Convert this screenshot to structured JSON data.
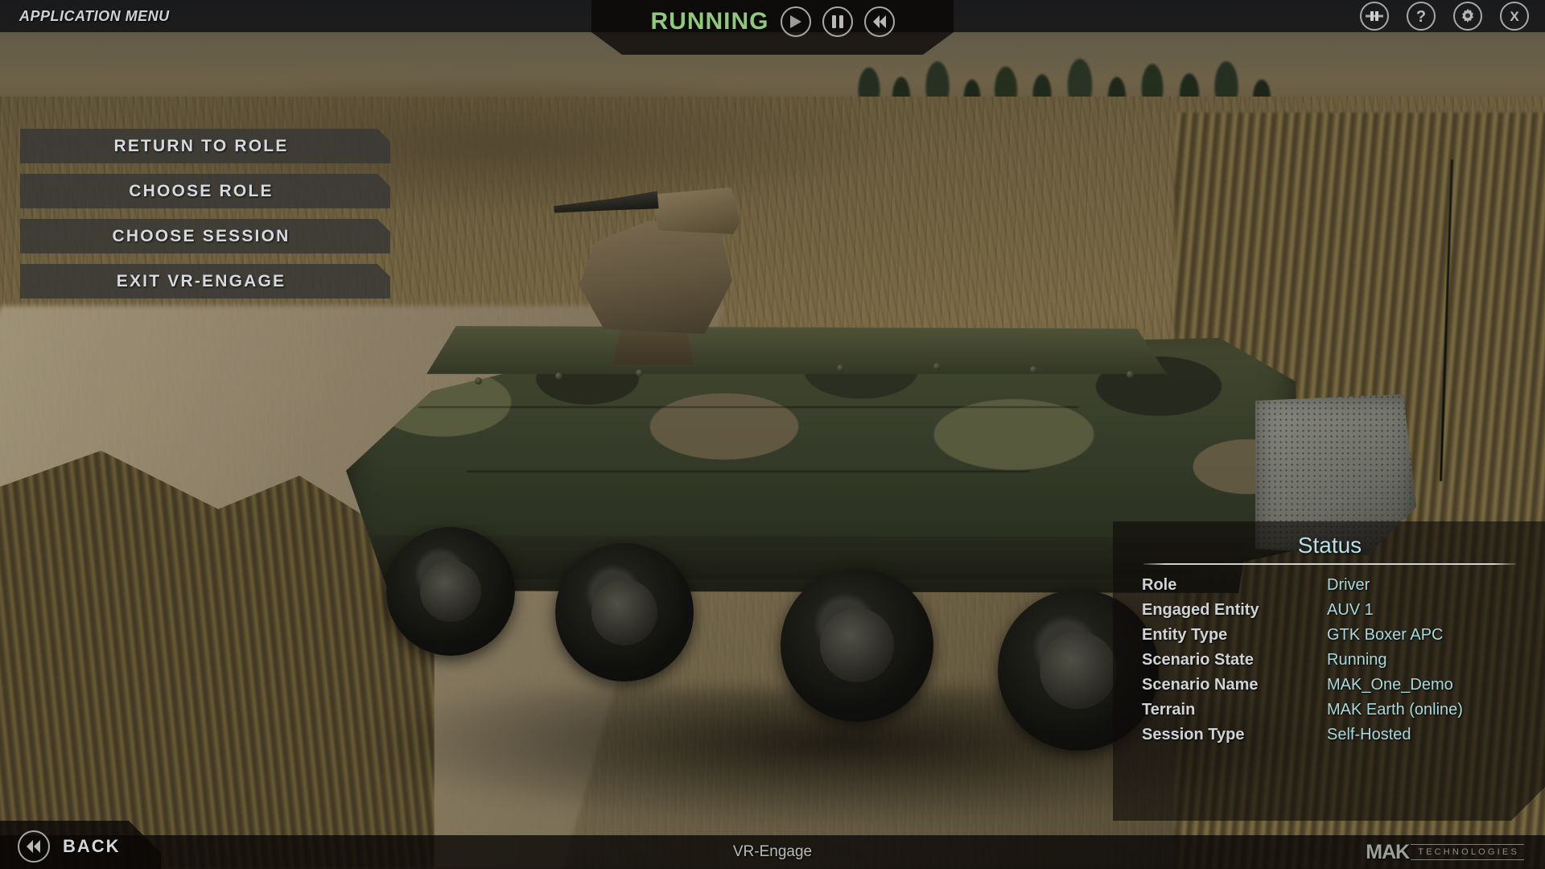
{
  "header": {
    "app_menu_title": "APPLICATION MENU",
    "status_word": "RUNNING",
    "playback": [
      {
        "name": "play-icon",
        "label": "Play"
      },
      {
        "name": "pause-icon",
        "label": "Pause"
      },
      {
        "name": "rewind-icon",
        "label": "Rewind"
      }
    ],
    "right_icons": [
      {
        "name": "sliders-icon",
        "label": "Simulation Controls"
      },
      {
        "name": "help-icon",
        "label": "Help"
      },
      {
        "name": "gear-icon",
        "label": "Settings"
      },
      {
        "name": "close-icon",
        "label": "Close"
      }
    ]
  },
  "menu": {
    "buttons": [
      {
        "label": "RETURN TO ROLE"
      },
      {
        "label": "CHOOSE ROLE"
      },
      {
        "label": "CHOOSE SESSION"
      },
      {
        "label": "EXIT VR-ENGAGE"
      }
    ]
  },
  "status_panel": {
    "title": "Status",
    "label_color": "#cfd3d6",
    "value_color": "#a7d8dd",
    "rows": [
      {
        "label": "Role",
        "value": "Driver"
      },
      {
        "label": "Engaged Entity",
        "value": "AUV 1"
      },
      {
        "label": "Entity Type",
        "value": "GTK Boxer APC"
      },
      {
        "label": "Scenario State",
        "value": "Running"
      },
      {
        "label": "Scenario Name",
        "value": "MAK_One_Demo"
      },
      {
        "label": "Terrain",
        "value": "MAK Earth (online)"
      },
      {
        "label": "Session Type",
        "value": "Self-Hosted"
      }
    ]
  },
  "footer": {
    "back_label": "BACK",
    "back_icon": "double-chevron-left-icon",
    "app_name": "VR-Engage",
    "brand_primary": "MAK",
    "brand_secondary": "TECHNOLOGIES"
  },
  "colors": {
    "status_running": "#8fc97a",
    "panel_value": "#a7d8dd",
    "button_text": "#d5dade",
    "bar_background": "rgba(10,8,6,.78)"
  }
}
